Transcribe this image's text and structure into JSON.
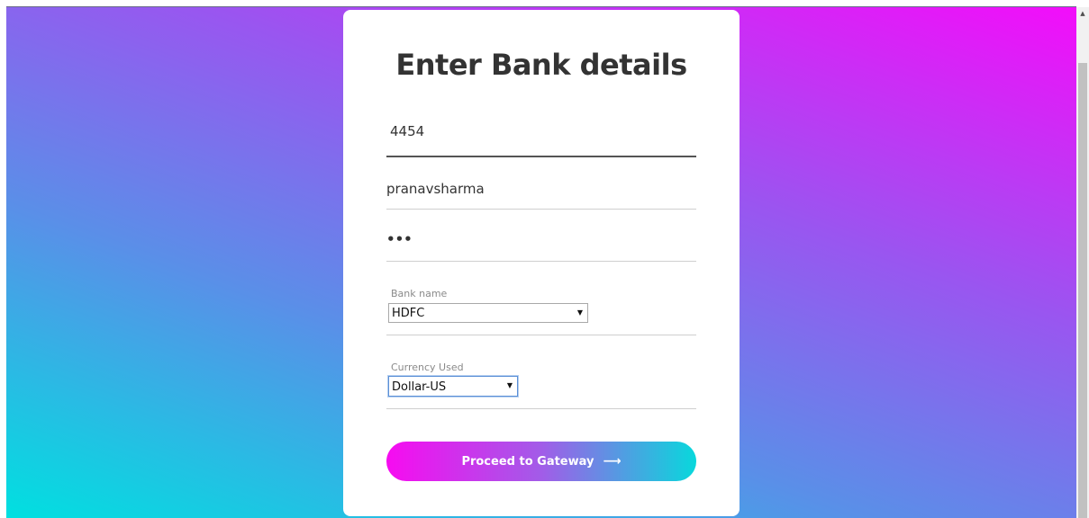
{
  "form": {
    "title": "Enter Bank details",
    "account_number": "4454",
    "username": "pranavsharma",
    "password_masked": "•••",
    "bank": {
      "label": "Bank name",
      "selected": "HDFC"
    },
    "currency": {
      "label": "Currency Used",
      "selected": "Dollar-US"
    },
    "submit_label": "Proceed to Gateway",
    "submit_arrow": "⟶"
  },
  "theme": {
    "gradient_start": "#00e0e0",
    "gradient_end": "#f30dfa",
    "button_start": "#f70bf0",
    "button_end": "#08d8dc"
  }
}
